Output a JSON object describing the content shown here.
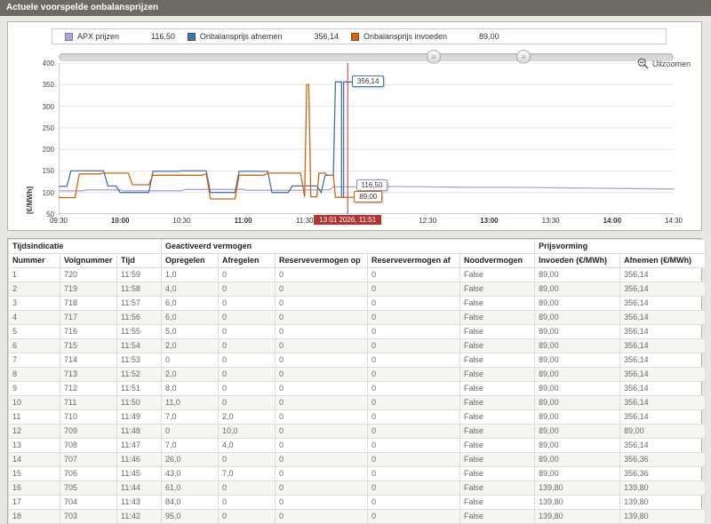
{
  "header": {
    "title": "Actuele voorspelde onbalansprijzen"
  },
  "toolbar": {
    "zoom_out_label": "Uitzoomen"
  },
  "legend": {
    "items": [
      {
        "label": "APX prijzen",
        "value": "116,50",
        "color": "#aea3dd"
      },
      {
        "label": "Onbalansprijs afnemen",
        "value": "356,14",
        "color": "#4572a7"
      },
      {
        "label": "Onbalansprijs invoeden",
        "value": "89,00",
        "color": "#cc6611"
      }
    ]
  },
  "chart_data": {
    "type": "line",
    "ylabel": "[€/MWh]",
    "ylim": [
      50,
      400
    ],
    "yticks": [
      50,
      100,
      150,
      200,
      250,
      300,
      350,
      400
    ],
    "x_range_minutes": [
      0,
      300
    ],
    "xticks": [
      {
        "label": "09:30",
        "minute": 0,
        "bold": false
      },
      {
        "label": "10:00",
        "minute": 30,
        "bold": true
      },
      {
        "label": "10:30",
        "minute": 60,
        "bold": false
      },
      {
        "label": "11:00",
        "minute": 90,
        "bold": true
      },
      {
        "label": "11:30",
        "minute": 120,
        "bold": false
      },
      {
        "label": "12:00",
        "minute": 150,
        "bold": true
      },
      {
        "label": "12:30",
        "minute": 180,
        "bold": false
      },
      {
        "label": "13:00",
        "minute": 210,
        "bold": true
      },
      {
        "label": "13:30",
        "minute": 240,
        "bold": false
      },
      {
        "label": "14:00",
        "minute": 270,
        "bold": true
      },
      {
        "label": "14:30",
        "minute": 300,
        "bold": false
      }
    ],
    "series": [
      {
        "name": "APX prijzen",
        "color": "#aea3dd",
        "points": [
          [
            0,
            104
          ],
          [
            12,
            104
          ],
          [
            14,
            106
          ],
          [
            30,
            106
          ],
          [
            32,
            104
          ],
          [
            60,
            104
          ],
          [
            62,
            107
          ],
          [
            90,
            107
          ],
          [
            92,
            105
          ],
          [
            118,
            105
          ],
          [
            120,
            106
          ],
          [
            132,
            106
          ],
          [
            134,
            113
          ],
          [
            150,
            113
          ],
          [
            152,
            116.5
          ],
          [
            158,
            116.5
          ],
          [
            160,
            114
          ],
          [
            180,
            113
          ],
          [
            200,
            112
          ],
          [
            220,
            112
          ],
          [
            240,
            111
          ],
          [
            260,
            110
          ],
          [
            280,
            109
          ],
          [
            300,
            108
          ]
        ]
      },
      {
        "name": "Onbalansprijs afnemen",
        "color": "#4572a7",
        "points": [
          [
            0,
            114
          ],
          [
            4,
            114
          ],
          [
            6,
            150
          ],
          [
            22,
            150
          ],
          [
            24,
            115
          ],
          [
            28,
            115
          ],
          [
            30,
            100
          ],
          [
            44,
            100
          ],
          [
            46,
            149
          ],
          [
            58,
            149
          ],
          [
            60,
            150
          ],
          [
            72,
            150
          ],
          [
            74,
            100
          ],
          [
            86,
            100
          ],
          [
            88,
            149
          ],
          [
            102,
            149
          ],
          [
            104,
            100
          ],
          [
            112,
            100
          ],
          [
            114,
            115
          ],
          [
            126,
            115
          ],
          [
            128,
            100
          ],
          [
            130,
            139.8
          ],
          [
            134,
            139.8
          ],
          [
            135,
            356.36
          ],
          [
            137,
            356.36
          ],
          [
            138,
            356.14
          ],
          [
            138,
            89
          ],
          [
            139,
            89
          ],
          [
            139,
            356.14
          ],
          [
            158,
            356.14
          ]
        ]
      },
      {
        "name": "Onbalansprijs invoeden",
        "color": "#cc6611",
        "points": [
          [
            0,
            88
          ],
          [
            8,
            88
          ],
          [
            10,
            143
          ],
          [
            20,
            143
          ],
          [
            22,
            145
          ],
          [
            34,
            145
          ],
          [
            36,
            118
          ],
          [
            44,
            118
          ],
          [
            46,
            140
          ],
          [
            70,
            140
          ],
          [
            72,
            143
          ],
          [
            74,
            85
          ],
          [
            86,
            85
          ],
          [
            88,
            140
          ],
          [
            100,
            140
          ],
          [
            102,
            145
          ],
          [
            118,
            145
          ],
          [
            120,
            90
          ],
          [
            121,
            350
          ],
          [
            122,
            350
          ],
          [
            123,
            90
          ],
          [
            126,
            90
          ],
          [
            127,
            145
          ],
          [
            130,
            145
          ],
          [
            131,
            139.8
          ],
          [
            134,
            139.8
          ],
          [
            135,
            89
          ],
          [
            158,
            89
          ]
        ]
      }
    ],
    "marker": {
      "label": "13 01 2026, 11:51",
      "minute": 141,
      "color": "#c0392b"
    },
    "annotations": [
      {
        "label": "356,14",
        "minute": 140,
        "value": 356.14,
        "color": "#4572a7"
      },
      {
        "label": "116,50",
        "minute": 142,
        "value": 116.5,
        "color": "#9b90cf"
      },
      {
        "label": "89,00",
        "minute": 141,
        "value": 89,
        "color": "#cc6611"
      }
    ],
    "scrollbar": {
      "handles": [
        0.61,
        0.756
      ]
    }
  },
  "table": {
    "groups": [
      {
        "label": "Tijdsindicatie",
        "span": 3
      },
      {
        "label": "Geactiveerd vermogen",
        "span": 5
      },
      {
        "label": "Prijsvorming",
        "span": 2
      }
    ],
    "columns": [
      "Nummer",
      "Volgnummer",
      "Tijd",
      "Opregelen",
      "Afregelen",
      "Reservevermogen op",
      "Reservevermogen af",
      "Noodvermogen",
      "Invoeden (€/MWh)",
      "Afnemen (€/MWh)"
    ],
    "rows": [
      [
        "1",
        "720",
        "11:59",
        "1,0",
        "0",
        "0",
        "0",
        "False",
        "89,00",
        "356,14"
      ],
      [
        "2",
        "719",
        "11:58",
        "4,0",
        "0",
        "0",
        "0",
        "False",
        "89,00",
        "356,14"
      ],
      [
        "3",
        "718",
        "11:57",
        "6,0",
        "0",
        "0",
        "0",
        "False",
        "89,00",
        "356,14"
      ],
      [
        "4",
        "717",
        "11:56",
        "6,0",
        "0",
        "0",
        "0",
        "False",
        "89,00",
        "356,14"
      ],
      [
        "5",
        "716",
        "11:55",
        "5,0",
        "0",
        "0",
        "0",
        "False",
        "89,00",
        "356,14"
      ],
      [
        "6",
        "715",
        "11:54",
        "2,0",
        "0",
        "0",
        "0",
        "False",
        "89,00",
        "356,14"
      ],
      [
        "7",
        "714",
        "11:53",
        "0",
        "0",
        "0",
        "0",
        "False",
        "89,00",
        "356,14"
      ],
      [
        "8",
        "713",
        "11:52",
        "2,0",
        "0",
        "0",
        "0",
        "False",
        "89,00",
        "356,14"
      ],
      [
        "9",
        "712",
        "11:51",
        "8,0",
        "0",
        "0",
        "0",
        "False",
        "89,00",
        "356,14"
      ],
      [
        "10",
        "711",
        "11:50",
        "11,0",
        "0",
        "0",
        "0",
        "False",
        "89,00",
        "356,14"
      ],
      [
        "11",
        "710",
        "11:49",
        "7,0",
        "2,0",
        "0",
        "0",
        "False",
        "89,00",
        "356,14"
      ],
      [
        "12",
        "709",
        "11:48",
        "0",
        "10,0",
        "0",
        "0",
        "False",
        "89,00",
        "89,00"
      ],
      [
        "13",
        "708",
        "11:47",
        "7,0",
        "4,0",
        "0",
        "0",
        "False",
        "89,00",
        "356,14"
      ],
      [
        "14",
        "707",
        "11:46",
        "26,0",
        "0",
        "0",
        "0",
        "False",
        "89,00",
        "356,36"
      ],
      [
        "15",
        "706",
        "11:45",
        "43,0",
        "7,0",
        "0",
        "0",
        "False",
        "89,00",
        "356,36"
      ],
      [
        "16",
        "705",
        "11:44",
        "61,0",
        "0",
        "0",
        "0",
        "False",
        "139,80",
        "139,80"
      ],
      [
        "17",
        "704",
        "11:43",
        "84,0",
        "0",
        "0",
        "0",
        "False",
        "139,80",
        "139,80"
      ],
      [
        "18",
        "703",
        "11:42",
        "95,0",
        "0",
        "0",
        "0",
        "False",
        "139,80",
        "139,80"
      ]
    ]
  }
}
